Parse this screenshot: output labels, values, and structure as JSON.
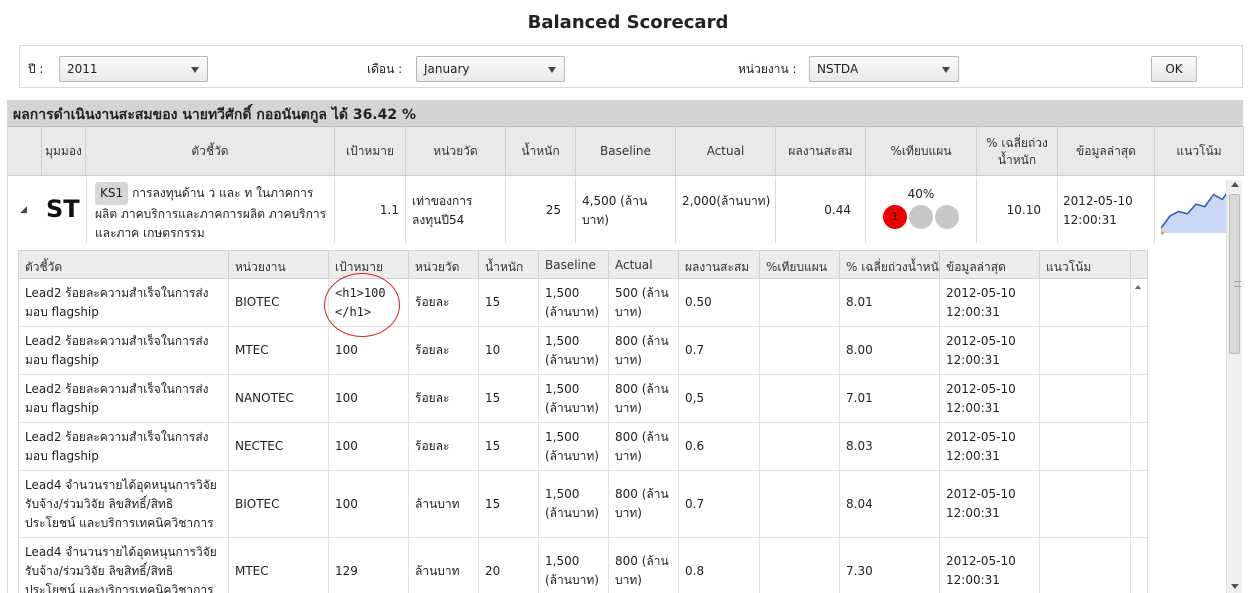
{
  "title": "Balanced Scorecard",
  "filters": {
    "year_label": "ปี :",
    "year_value": "2011",
    "month_label": "เดือน :",
    "month_value": "January",
    "unit_label": "หน่วยงาน :",
    "unit_value": "NSTDA",
    "ok_label": "OK"
  },
  "summary": "ผลการดำเนินงานสะสมของ นายทวีศักดิ์ กออนันตกูล ได้ 36.42 %",
  "outer_headers": [
    "มุมมอง",
    "ตัวชี้วัด",
    "เป้าหมาย",
    "หน่วยวัด",
    "น้ำหนัก",
    "Baseline",
    "Actual",
    "ผลงานสะสม",
    "%เทียบแผน",
    "% เฉลี่ยถ่วงน้ำหนัก",
    "ข้อมูลล่าสุด",
    "แนวโน้ม"
  ],
  "outer_row": {
    "perspective": "ST",
    "kpi_code": "KS1",
    "kpi_text": "การลงทุนด้าน ว และ ท ในภาคการผลิต ภาคบริการและภาคการผลิต ภาคบริการและภาค เกษตรกรรม",
    "target": "1.1",
    "unit": "เท่าของการลงทุนปี54",
    "weight": "25",
    "baseline": "4,500 (ล้านบาท)",
    "actual": "2,000(ล้านบาท)",
    "accumulated": "0.44",
    "plan_percent": "40%",
    "light_label": "1",
    "avg_weighted": "10.10",
    "latest": "2012-05-10 12:00:31",
    "trend_values": [
      0.1,
      0.35,
      0.45,
      0.4,
      0.6,
      0.55,
      0.8,
      0.7,
      0.95
    ]
  },
  "inner_headers": [
    "ตัวชี้วัด",
    "หน่วยงาน",
    "เป้าหมาย",
    "หน่วยวัด",
    "น้ำหนัก",
    "Baseline",
    "Actual",
    "ผลงานสะสม",
    "%เทียบแผน",
    "% เฉลี่ยถ่วงน้ำหนัก",
    "ข้อมูลล่าสุด",
    "แนวโน้ม"
  ],
  "inner_rows": [
    {
      "kpi": "Lead2 ร้อยละความสำเร็จในการส่งมอบ flagship",
      "agency": "BIOTEC",
      "target": "<h1>100 </h1>",
      "unit": "ร้อยละ",
      "weight": "15",
      "baseline": "1,500 (ล้านบาท)",
      "actual": "500 (ล้าน บาท)",
      "accumulated": "0.50",
      "plan": "",
      "avg": "8.01",
      "latest": "2012-05-10 12:00:31"
    },
    {
      "kpi": "Lead2 ร้อยละความสำเร็จในการส่งมอบ flagship",
      "agency": "MTEC",
      "target": "100",
      "unit": "ร้อยละ",
      "weight": "10",
      "baseline": "1,500 (ล้านบาท)",
      "actual": "800 (ล้าน บาท)",
      "accumulated": "0.7",
      "plan": "",
      "avg": "8.00",
      "latest": "2012-05-10 12:00:31"
    },
    {
      "kpi": "Lead2 ร้อยละความสำเร็จในการส่งมอบ flagship",
      "agency": "NANOTEC",
      "target": "100",
      "unit": "ร้อยละ",
      "weight": "15",
      "baseline": "1,500 (ล้านบาท)",
      "actual": "800 (ล้าน บาท)",
      "accumulated": "0,5",
      "plan": "",
      "avg": "7.01",
      "latest": "2012-05-10 12:00:31"
    },
    {
      "kpi": "Lead2 ร้อยละความสำเร็จในการส่งมอบ flagship",
      "agency": "NECTEC",
      "target": "100",
      "unit": "ร้อยละ",
      "weight": "15",
      "baseline": "1,500 (ล้านบาท)",
      "actual": "800 (ล้าน บาท)",
      "accumulated": "0.6",
      "plan": "",
      "avg": "8.03",
      "latest": "2012-05-10 12:00:31"
    },
    {
      "kpi": "Lead4 จำนวนรายได้อุดหนุนการวิจัย รับจ้าง/ร่วมวิจัย ลิขสิทธิ์/สิทธิประโยชน์ และบริการเทคนิควิชาการ",
      "agency": "BIOTEC",
      "target": "100",
      "unit": "ล้านบาท",
      "weight": "15",
      "baseline": "1,500 (ล้านบาท)",
      "actual": "800 (ล้าน บาท)",
      "accumulated": "0.7",
      "plan": "",
      "avg": "8.04",
      "latest": "2012-05-10 12:00:31"
    },
    {
      "kpi": "Lead4 จำนวนรายได้อุดหนุนการวิจัย รับจ้าง/ร่วมวิจัย ลิขสิทธิ์/สิทธิประโยชน์ และบริการเทคนิควิชาการ",
      "agency": "MTEC",
      "target": "129",
      "unit": "ล้านบาท",
      "weight": "20",
      "baseline": "1,500 (ล้านบาท)",
      "actual": "800 (ล้าน บาท)",
      "accumulated": "0.8",
      "plan": "",
      "avg": "7.30",
      "latest": "2012-05-10 12:00:31"
    }
  ]
}
